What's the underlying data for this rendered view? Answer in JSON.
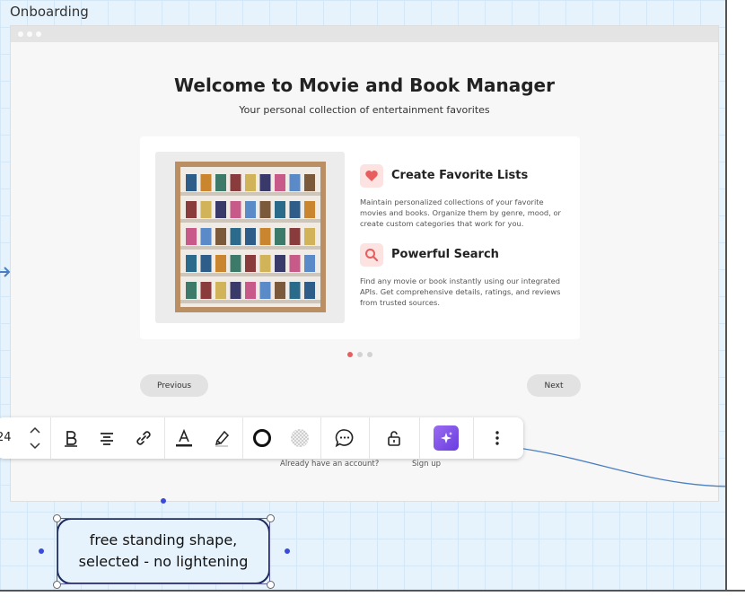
{
  "board": {
    "label": "Onboarding"
  },
  "screen": {
    "title": "Welcome to Movie and Book Manager",
    "subtitle": "Your personal collection of entertainment favorites",
    "features": [
      {
        "icon": "heart-icon",
        "title": "Create Favorite Lists",
        "desc": "Maintain personalized collections of your favorite movies and books. Organize them by genre, mood, or create custom categories that work for you."
      },
      {
        "icon": "search-icon",
        "title": "Powerful Search",
        "desc": "Find any movie or book instantly using our integrated APIs. Get comprehensive details, ratings, and reviews from trusted sources."
      }
    ],
    "pagination": {
      "total": 3,
      "active": 1
    },
    "previous_label": "Previous",
    "next_label": "Next",
    "account_prompt": "Already have an account?",
    "signup_label": "Sign up"
  },
  "toolbar": {
    "font_size": "24",
    "items": [
      "chevron-up-icon",
      "chevron-down-icon",
      "bold-icon",
      "align-center-icon",
      "link-icon",
      "text-color-icon",
      "highlighter-icon",
      "border-circle-icon",
      "fill-transparent-icon",
      "comment-icon",
      "unlock-icon",
      "ai-sparkle-icon",
      "more-vertical-icon"
    ]
  },
  "shape": {
    "line1": "free standing shape,",
    "line2": "selected - no lightening"
  },
  "colors": {
    "accent_red": "#e85d5d",
    "icon_bg_pink": "#fde2e2",
    "ai_purple": "#7b4de8",
    "connector_blue": "#4a7fc0",
    "selection_blue": "#3a4bd8"
  }
}
